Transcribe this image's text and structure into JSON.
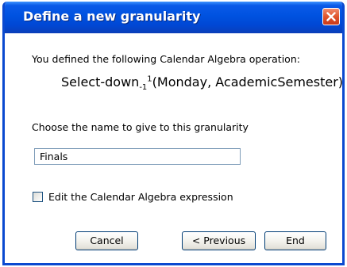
{
  "dialog": {
    "title": "Define a new granularity",
    "close_icon": "close-x-icon",
    "title_bar_color": "#0a55e0",
    "close_button_color": "#e0552c"
  },
  "content": {
    "defined_label": "You defined the following Calendar Algebra operation:",
    "operation": {
      "name": "Select-down",
      "subscript": "-1",
      "superscript": "1",
      "arguments": "(Monday, AcademicSemester)"
    },
    "choose_label": "Choose the name to give to this granularity",
    "name_input_value": "Finals",
    "edit_checkbox": {
      "label": "Edit the Calendar Algebra expression",
      "checked": false
    }
  },
  "buttons": {
    "cancel": "Cancel",
    "previous": "< Previous",
    "end": "End"
  }
}
